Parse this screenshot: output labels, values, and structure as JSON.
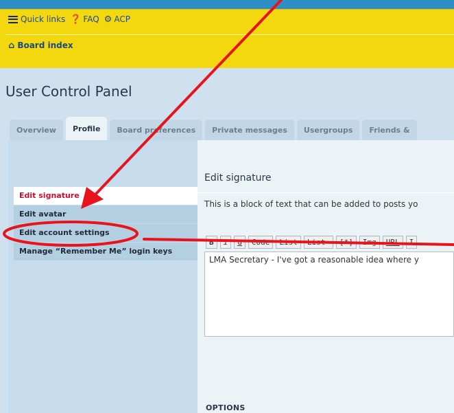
{
  "nav": {
    "quick_links": "Quick links",
    "faq": "FAQ",
    "acp": "ACP",
    "board_index": "Board index"
  },
  "page_title": "User Control Panel",
  "tabs": [
    {
      "label": "Overview"
    },
    {
      "label": "Profile",
      "active": true
    },
    {
      "label": "Board preferences"
    },
    {
      "label": "Private messages"
    },
    {
      "label": "Usergroups"
    },
    {
      "label": "Friends &"
    }
  ],
  "sidebar": {
    "items": [
      {
        "label": "Edit signature",
        "active": true
      },
      {
        "label": "Edit avatar"
      },
      {
        "label": "Edit account settings"
      },
      {
        "label": "Manage “Remember Me” login keys"
      }
    ]
  },
  "content": {
    "title": "Edit signature",
    "description": "This is a block of text that can be added to posts yo",
    "toolbar": [
      "B",
      "i",
      "u",
      "Code",
      "List",
      "List=",
      "[*]",
      "Img",
      "URL",
      "I"
    ],
    "signature_text": "LMA Secretary - I've got a reasonable idea where y",
    "options_label": "OPTIONS"
  },
  "colors": {
    "nav_yellow": "#f4d80f",
    "top_blue": "#2f8dc8",
    "active_red": "#c8102e",
    "annotation_red": "#e8141c"
  },
  "icons": {
    "quick_links": "hamburger-icon",
    "faq": "question-icon",
    "acp": "gears-icon",
    "board_index": "home-icon"
  }
}
